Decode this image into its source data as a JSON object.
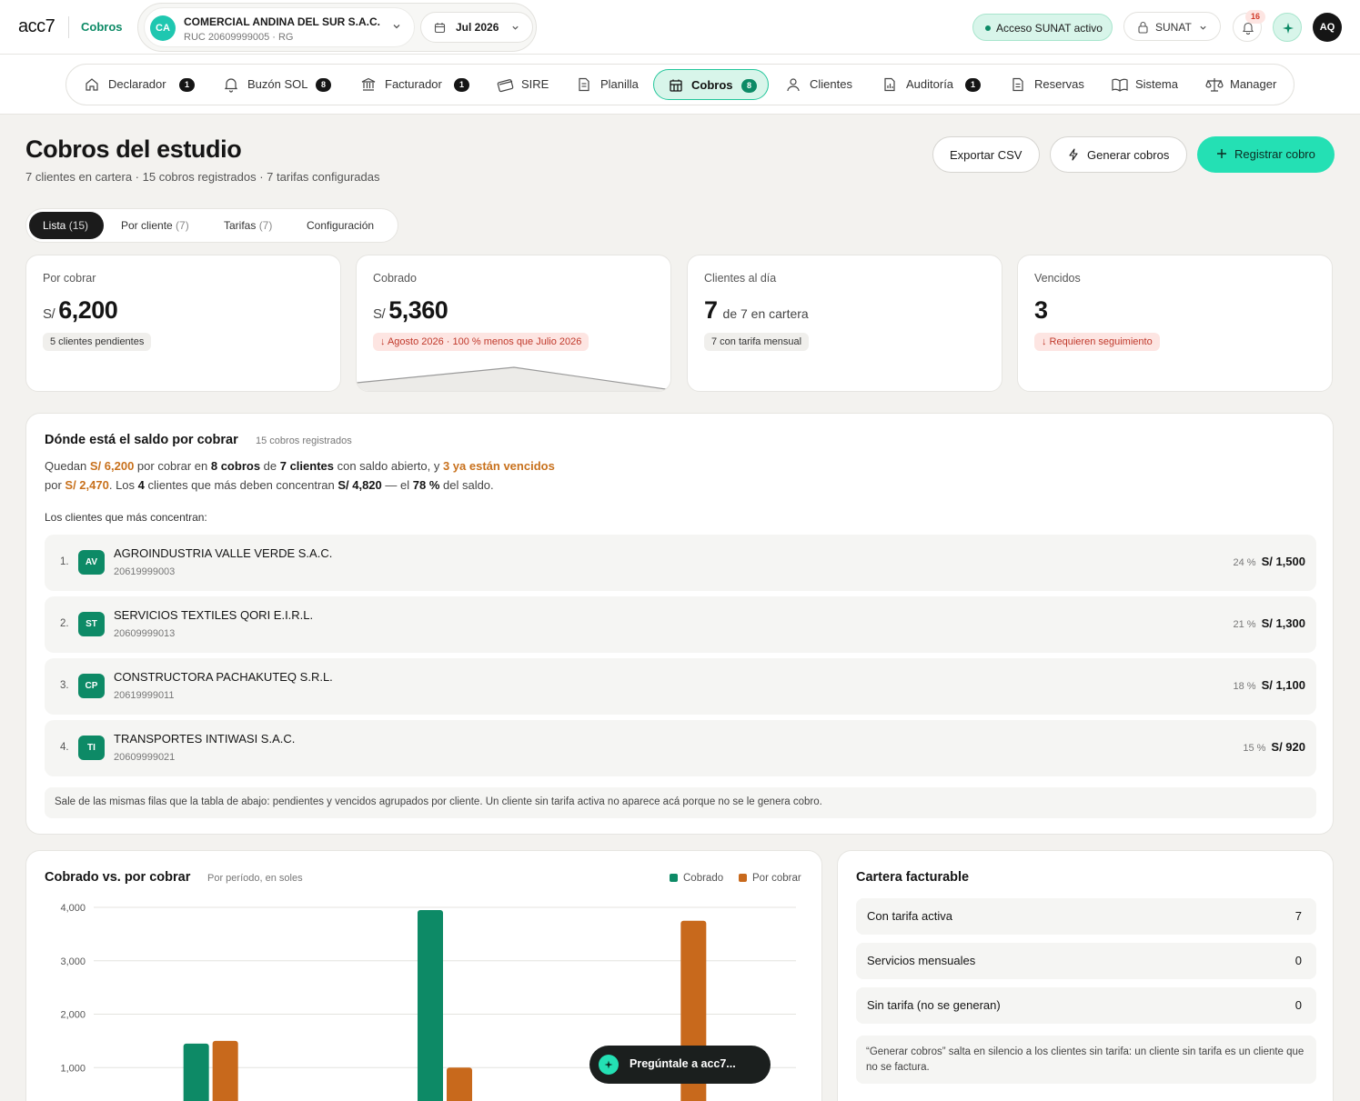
{
  "header": {
    "logo": "acc7",
    "module": "Cobros",
    "company": {
      "initials": "CA",
      "name": "COMERCIAL ANDINA DEL SUR S.A.C.",
      "ruc": "RUC 20609999005 · RG"
    },
    "period": "Jul 2026",
    "sunat_access": "Acceso SUNAT activo",
    "sunat_button": "SUNAT",
    "notifications_count": "16",
    "user_initials": "AQ"
  },
  "nav": {
    "items": [
      {
        "label": "Declarador",
        "badge": "1",
        "icon": "home-icon"
      },
      {
        "label": "Buzón SOL",
        "badge": "8",
        "icon": "bell-icon"
      },
      {
        "label": "Facturador",
        "badge": "1",
        "icon": "bank-icon"
      },
      {
        "label": "SIRE",
        "badge": "",
        "icon": "card-icon"
      },
      {
        "label": "Planilla",
        "badge": "",
        "icon": "payroll-icon"
      },
      {
        "label": "Cobros",
        "badge": "8",
        "icon": "cobros-icon",
        "active": true
      },
      {
        "label": "Clientes",
        "badge": "",
        "icon": "user-icon"
      },
      {
        "label": "Auditoría",
        "badge": "1",
        "icon": "audit-icon"
      },
      {
        "label": "Reservas",
        "badge": "",
        "icon": "document-icon"
      },
      {
        "label": "Sistema",
        "badge": "",
        "icon": "book-icon"
      },
      {
        "label": "Manager",
        "badge": "",
        "icon": "scale-icon"
      }
    ]
  },
  "page": {
    "title": "Cobros del estudio",
    "subtitle": "7 clientes en cartera · 15 cobros registrados · 7 tarifas configuradas",
    "export_label": "Exportar CSV",
    "generate_label": "Generar cobros",
    "register_label": "Registrar cobro"
  },
  "tabs": [
    {
      "label": "Lista",
      "count": "(15)",
      "active": true
    },
    {
      "label": "Por cliente",
      "count": "(7)"
    },
    {
      "label": "Tarifas",
      "count": "(7)"
    },
    {
      "label": "Configuración",
      "count": ""
    }
  ],
  "kpis": {
    "por_cobrar": {
      "label": "Por cobrar",
      "currency": "S/",
      "value": "6,200",
      "chip": "5 clientes pendientes"
    },
    "cobrado": {
      "label": "Cobrado",
      "currency": "S/",
      "value": "5,360",
      "chip": "↓ Agosto 2026 · 100 % menos que Julio 2026"
    },
    "al_dia": {
      "label": "Clientes al día",
      "value": "7",
      "suffix": "de 7 en cartera",
      "chip": "7 con tarifa mensual"
    },
    "vencidos": {
      "label": "Vencidos",
      "value": "3",
      "chip": "↓ Requieren seguimiento"
    }
  },
  "saldo": {
    "title": "Dónde está el saldo por cobrar",
    "subtitle": "15 cobros registrados",
    "line1": {
      "a": "Quedan ",
      "b": "S/ 6,200",
      "c": " por cobrar en ",
      "d": "8 cobros",
      "e": " de ",
      "f": "7 clientes",
      "g": " con saldo abierto, y ",
      "h": "3 ya están vencidos"
    },
    "line2": {
      "a": "por ",
      "b": "S/ 2,470",
      "c": ". Los ",
      "d": "4",
      "e": " clientes que más deben concentran ",
      "f": "S/ 4,820",
      "g": " — el ",
      "h": "78 %",
      "i": " del saldo."
    },
    "top_label": "Los clientes que más concentran:",
    "clients": [
      {
        "rank": "1.",
        "initials": "AV",
        "name": "AGROINDUSTRIA VALLE VERDE S.A.C.",
        "ruc": "20619999003",
        "pct": "24 %",
        "amount": "S/ 1,500"
      },
      {
        "rank": "2.",
        "initials": "ST",
        "name": "SERVICIOS TEXTILES QORI E.I.R.L.",
        "ruc": "20609999013",
        "pct": "21 %",
        "amount": "S/ 1,300"
      },
      {
        "rank": "3.",
        "initials": "CP",
        "name": "CONSTRUCTORA PACHAKUTEQ S.R.L.",
        "ruc": "20619999011",
        "pct": "18 %",
        "amount": "S/ 1,100"
      },
      {
        "rank": "4.",
        "initials": "TI",
        "name": "TRANSPORTES INTIWASI S.A.C.",
        "ruc": "20609999021",
        "pct": "15 %",
        "amount": "S/ 920"
      }
    ],
    "note": "Sale de las mismas filas que la tabla de abajo: pendientes y vencidos agrupados por cliente. Un cliente sin tarifa activa no aparece acá porque no se le genera cobro."
  },
  "chart": {
    "title": "Cobrado vs. por cobrar",
    "subtitle": "Por período, en soles",
    "legend": [
      "Cobrado",
      "Por cobrar"
    ]
  },
  "chart_data": {
    "type": "bar",
    "title": "Cobrado vs. por cobrar",
    "subtitle": "Por período, en soles",
    "categories": [
      "",
      "",
      ""
    ],
    "series": [
      {
        "name": "Cobrado",
        "color": "#0d8a66",
        "values": [
          1450,
          3950,
          0
        ]
      },
      {
        "name": "Por cobrar",
        "color": "#c8691c",
        "values": [
          1500,
          1000,
          3750
        ]
      }
    ],
    "yticks": [
      "1,000",
      "2,000",
      "3,000",
      "4,000"
    ],
    "ytick_values": [
      1000,
      2000,
      3000,
      4000
    ],
    "ylim": [
      0,
      4000
    ],
    "grid": true,
    "legend_position": "top-right"
  },
  "cartera": {
    "title": "Cartera facturable",
    "rows": [
      {
        "label": "Con tarifa activa",
        "value": "7"
      },
      {
        "label": "Servicios mensuales",
        "value": "0"
      },
      {
        "label": "Sin tarifa (no se generan)",
        "value": "0"
      }
    ],
    "note": "“Generar cobros” salta en silencio a los clientes sin tarifa: un cliente sin tarifa es un cliente que no se factura."
  },
  "assistant": {
    "label": "Pregúntale a acc7..."
  },
  "colors": {
    "accent": "#24e0b4",
    "green": "#0d8a66",
    "orange": "#c8691c",
    "red": "#c0392b"
  }
}
